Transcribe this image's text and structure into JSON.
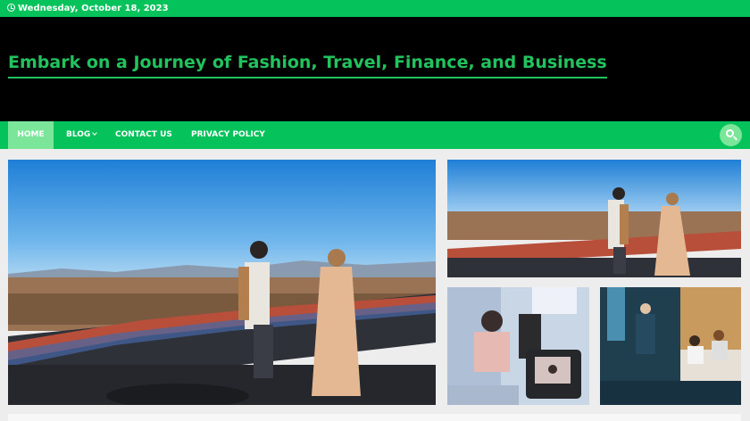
{
  "topbar": {
    "date": "Wednesday, October 18, 2023",
    "icon": "clock-icon"
  },
  "header": {
    "site_title": "Embark on a Journey of Fashion, Travel, Finance, and Business"
  },
  "nav": {
    "items": [
      {
        "label": "HOME",
        "active": true
      },
      {
        "label": "BLOG",
        "has_dropdown": true
      },
      {
        "label": "CONTACT US"
      },
      {
        "label": "PRIVACY POLICY"
      }
    ],
    "search_icon": "search-icon"
  },
  "featured": {
    "images": [
      {
        "name": "hero",
        "description_icon": "photo"
      },
      {
        "name": "top-right",
        "description_icon": "photo"
      },
      {
        "name": "bottom-left",
        "description_icon": "photo"
      },
      {
        "name": "bottom-right",
        "description_icon": "photo"
      }
    ]
  },
  "colors": {
    "accent": "#05c25a",
    "accent_light": "#7be69a",
    "header_bg": "#000000",
    "title": "#22c35e"
  }
}
